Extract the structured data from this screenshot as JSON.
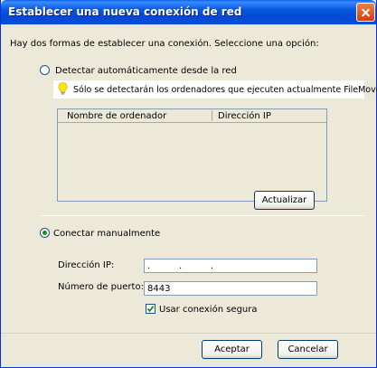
{
  "window": {
    "title": "Establecer una nueva conexión de red"
  },
  "intro_text": "Hay dos formas de establecer una conexión. Seleccione una opción:",
  "options": {
    "auto_label": "Detectar automáticamente desde la red",
    "auto_selected": false,
    "manual_label": "Conectar manualmente",
    "manual_selected": true
  },
  "info_text": "Sólo se detectarán los ordenadores que ejecuten actualmente FileMover",
  "computer_list": {
    "columns": [
      "Nombre de ordenador",
      "Dirección IP"
    ],
    "rows": []
  },
  "refresh_label": "Actualizar",
  "manual": {
    "ip_label": "Dirección IP:",
    "ip_value": ".          .          .",
    "port_label": "Número de puerto:",
    "port_value": "8443",
    "secure_label": "Usar conexión segura",
    "secure_checked": true
  },
  "buttons": {
    "ok": "Aceptar",
    "cancel": "Cancelar"
  },
  "colors": {
    "titlebar": "#0548d4",
    "window_bg": "#ece9d8",
    "close": "#d4400a",
    "check": "#1f8a1f"
  }
}
